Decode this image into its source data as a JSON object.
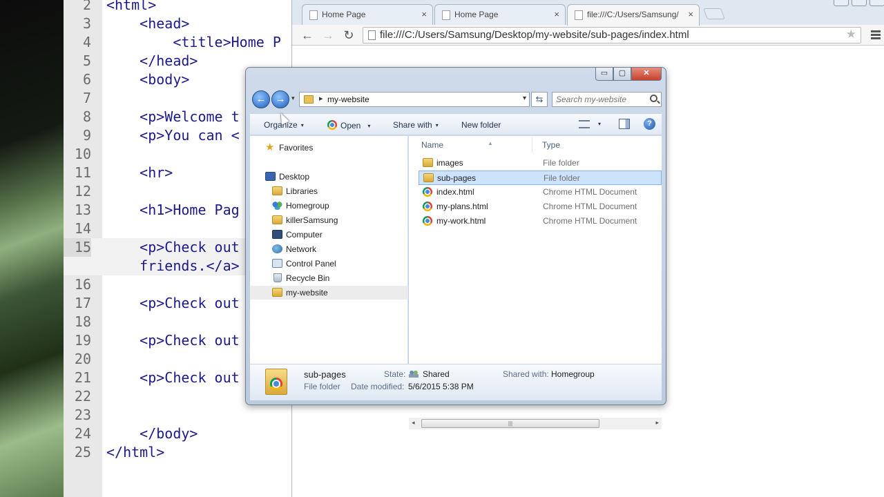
{
  "editor": {
    "lines": [
      {
        "n": "2",
        "text": "<html>"
      },
      {
        "n": "3",
        "text": "    <head>"
      },
      {
        "n": "4",
        "text": "        <title>Home P"
      },
      {
        "n": "5",
        "text": "    </head>"
      },
      {
        "n": "6",
        "text": "    <body>"
      },
      {
        "n": "7",
        "text": ""
      },
      {
        "n": "8",
        "text": "    <p>Welcome t"
      },
      {
        "n": "9",
        "text": "    <p>You can <"
      },
      {
        "n": "10",
        "text": ""
      },
      {
        "n": "11",
        "text": "    <hr>"
      },
      {
        "n": "12",
        "text": ""
      },
      {
        "n": "13",
        "text": "    <h1>Home Pag"
      },
      {
        "n": "14",
        "text": ""
      },
      {
        "n": "15",
        "text": "    <p>Check out",
        "cont": "    friends.</a>"
      },
      {
        "n": "16",
        "text": ""
      },
      {
        "n": "17",
        "text": "    <p>Check out"
      },
      {
        "n": "18",
        "text": ""
      },
      {
        "n": "19",
        "text": "    <p>Check out"
      },
      {
        "n": "20",
        "text": ""
      },
      {
        "n": "21",
        "text": "    <p>Check out"
      },
      {
        "n": "22",
        "text": ""
      },
      {
        "n": "23",
        "text": ""
      },
      {
        "n": "24",
        "text": "    </body>"
      },
      {
        "n": "25",
        "text": "</html>"
      }
    ]
  },
  "browser": {
    "tabs": [
      {
        "label": "Home Page",
        "close": "×"
      },
      {
        "label": "Home Page",
        "close": "×"
      },
      {
        "label": "file:///C:/Users/Samsung/",
        "close": "×"
      }
    ],
    "back": "←",
    "forward": "→",
    "reload": "↻",
    "url": "file:///C:/Users/Samsung/Desktop/my-website/sub-pages/index.html",
    "star": "★"
  },
  "explorer": {
    "caption": {
      "min": "▭",
      "max": "▢",
      "close": "✕"
    },
    "back_arrow": "←",
    "forward_arrow": "→",
    "recent": "▾",
    "crumb_sep": "▸",
    "breadcrumb": "my-website",
    "addr_dropdown": "▾",
    "refresh": "⇆",
    "search_placeholder": "Search my-website",
    "commands": {
      "organize": "Organize",
      "open": "Open",
      "share_with": "Share with",
      "new_folder": "New folder",
      "caret": "▾",
      "help": "?"
    },
    "nav": {
      "favorites": "Favorites",
      "desktop": "Desktop",
      "libraries": "Libraries",
      "homegroup": "Homegroup",
      "killersamsung": "killerSamsung",
      "computer": "Computer",
      "network": "Network",
      "control_panel": "Control Panel",
      "recycle_bin": "Recycle Bin",
      "my_website": "my-website"
    },
    "columns": {
      "name": "Name",
      "type": "Type",
      "sort": "▲"
    },
    "files": [
      {
        "name": "images",
        "type": "File folder",
        "kind": "folder"
      },
      {
        "name": "sub-pages",
        "type": "File folder",
        "kind": "folder"
      },
      {
        "name": "index.html",
        "type": "Chrome HTML Document",
        "kind": "chrome"
      },
      {
        "name": "my-plans.html",
        "type": "Chrome HTML Document",
        "kind": "chrome"
      },
      {
        "name": "my-work.html",
        "type": "Chrome HTML Document",
        "kind": "chrome"
      }
    ],
    "scroll": {
      "left": "◂",
      "right": "▸",
      "grip": "|||"
    },
    "details": {
      "name": "sub-pages",
      "kind": "File folder",
      "state_label": "State:",
      "state_value": "Shared",
      "date_label": "Date modified:",
      "date_value": "5/6/2015 5:38 PM",
      "shared_with_label": "Shared with:",
      "shared_with_value": "Homegroup"
    }
  }
}
